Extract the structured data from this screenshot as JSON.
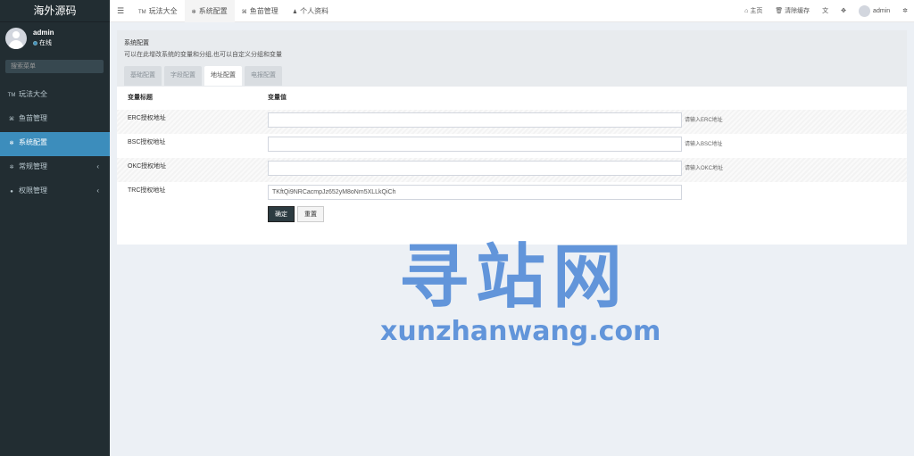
{
  "app": {
    "title": "海外源码"
  },
  "user": {
    "name": "admin",
    "status": "在线"
  },
  "sidebar": {
    "search_placeholder": "搜索菜单",
    "items": [
      {
        "label": "玩法大全",
        "icon": "TM"
      },
      {
        "label": "鱼苗管理",
        "icon": "fish-icon"
      },
      {
        "label": "系统配置",
        "icon": "gear-icon"
      },
      {
        "label": "常规管理",
        "icon": "cogs-icon"
      },
      {
        "label": "权限管理",
        "icon": "group-icon"
      }
    ]
  },
  "navbar": {
    "tabs": [
      {
        "label": "玩法大全",
        "icon": "TM"
      },
      {
        "label": "系统配置",
        "icon": "gear-icon"
      },
      {
        "label": "鱼苗管理",
        "icon": "fish-icon"
      },
      {
        "label": "个人资料",
        "icon": "user-icon"
      }
    ],
    "home_label": "主页",
    "clear_cache_label": "清除缓存",
    "username": "admin"
  },
  "main": {
    "title": "系统配置",
    "description": "可以在此增改系统的变量和分组,也可以自定义分组和变量",
    "subtabs": [
      "基础配置",
      "字段配置",
      "地址配置",
      "电报配置"
    ],
    "active_subtab": 2,
    "table": {
      "col_title": "变量标题",
      "col_value": "变量值",
      "rows": [
        {
          "label": "ERC授权地址",
          "value": "",
          "hint": "请输入ERC地址"
        },
        {
          "label": "BSC授权地址",
          "value": "",
          "hint": "请输入BSC地址"
        },
        {
          "label": "OKC授权地址",
          "value": "",
          "hint": "请输入OKC地址"
        },
        {
          "label": "TRC授权地址",
          "value": "TKftQi9NRCacmpJz652yM8oNm5XLLkQiCh",
          "hint": ""
        }
      ]
    },
    "confirm_label": "确定",
    "reset_label": "重置"
  },
  "watermark": {
    "cn": "寻站网",
    "en": "xunzhanwang.com"
  }
}
